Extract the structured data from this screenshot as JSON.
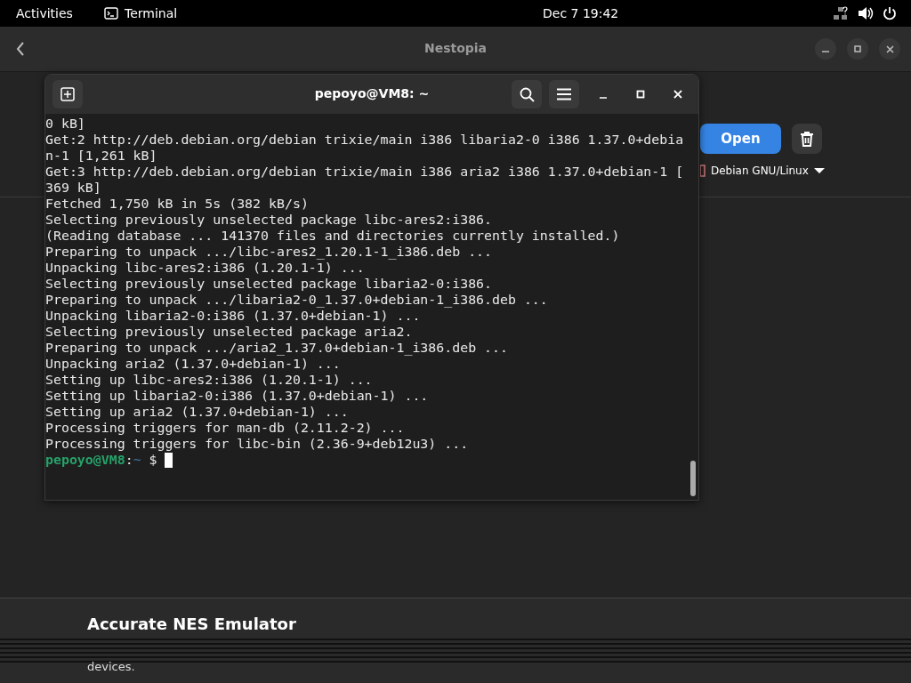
{
  "top_bar": {
    "activities": "Activities",
    "app_name": "Terminal",
    "clock": "Dec 7  19:42"
  },
  "app_window": {
    "title": "Nestopia",
    "open_button": "Open",
    "platform": "Debian GNU/Linux",
    "summary_title": "Accurate NES Emulator",
    "summary_text": "devices."
  },
  "terminal": {
    "title": "pepoyo@VM8: ~",
    "lines": [
      "0 kB]",
      "Get:2 http://deb.debian.org/debian trixie/main i386 libaria2-0 i386 1.37.0+debia",
      "n-1 [1,261 kB]",
      "Get:3 http://deb.debian.org/debian trixie/main i386 aria2 i386 1.37.0+debian-1 [",
      "369 kB]",
      "Fetched 1,750 kB in 5s (382 kB/s)",
      "Selecting previously unselected package libc-ares2:i386.",
      "(Reading database ... 141370 files and directories currently installed.)",
      "Preparing to unpack .../libc-ares2_1.20.1-1_i386.deb ...",
      "Unpacking libc-ares2:i386 (1.20.1-1) ...",
      "Selecting previously unselected package libaria2-0:i386.",
      "Preparing to unpack .../libaria2-0_1.37.0+debian-1_i386.deb ...",
      "Unpacking libaria2-0:i386 (1.37.0+debian-1) ...",
      "Selecting previously unselected package aria2.",
      "Preparing to unpack .../aria2_1.37.0+debian-1_i386.deb ...",
      "Unpacking aria2 (1.37.0+debian-1) ...",
      "Setting up libc-ares2:i386 (1.20.1-1) ...",
      "Setting up libaria2-0:i386 (1.37.0+debian-1) ...",
      "Setting up aria2 (1.37.0+debian-1) ...",
      "Processing triggers for man-db (2.11.2-2) ...",
      "Processing triggers for libc-bin (2.36-9+deb12u3) ..."
    ],
    "prompt": {
      "user": "pepoyo@VM8",
      "separator": ":",
      "path": "~",
      "symbol": "$"
    }
  }
}
